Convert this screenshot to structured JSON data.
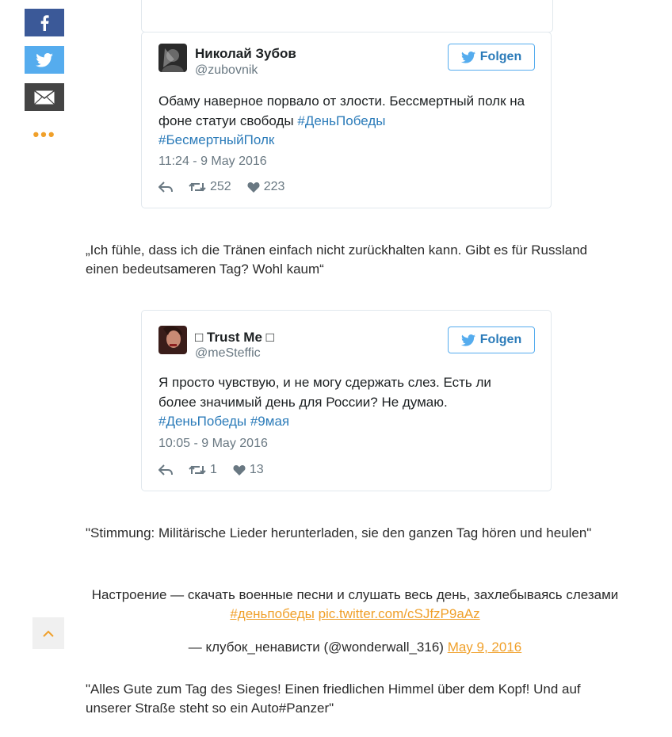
{
  "share": {
    "facebook_icon": "facebook-icon",
    "twitter_icon": "twitter-icon",
    "email_icon": "email-icon",
    "more_icon": "more-dots-icon"
  },
  "colors": {
    "facebook": "#3b5998",
    "twitter": "#55acee",
    "email": "#444444",
    "accent": "#f0a02a",
    "link_blue": "#2b7bb9"
  },
  "tweets": [
    {
      "name": "Николай Зубов",
      "handle": "@zubovnik",
      "follow_label": "Folgen",
      "text": "Обаму наверное порвало от злости. Бессмертный полк на фоне статуи свободы",
      "tags": [
        "#ДеньПобеды",
        "#БесмертныйПолк"
      ],
      "time": "11:24 - 9 May 2016",
      "retweets": "252",
      "likes": "223"
    },
    {
      "name": "□ Trust Me □",
      "handle": "@meSteffic",
      "follow_label": "Folgen",
      "text": "Я просто чувствую, и не могу сдержать слез. Есть ли более значимый день для России? Не думаю.",
      "tags": [
        "#ДеньПобеды",
        "#9мая"
      ],
      "time": "10:05 - 9 May 2016",
      "retweets": "1",
      "likes": "13"
    }
  ],
  "paragraphs": {
    "p1": " „Ich fühle, dass ich die Tränen einfach nicht zurückhalten kann. Gibt es für Russland einen bedeutsameren Tag? Wohl kaum“",
    "p2": "\"Stimmung: Militärische Lieder herunterladen, sie den ganzen Tag hören und heulen\"",
    "p3": "\"Alles Gute zum Tag des Sieges! Einen friedlichen Himmel über dem Kopf! Und auf unserer Straße steht so ein Auto#Panzer\""
  },
  "embed_quote": {
    "text": "Настроение — скачать военные песни и слушать весь день, захлебываясь слезами",
    "hashtag": "#деньпобеды",
    "pic_link": "pic.twitter.com/cSJfzP9aAz",
    "attribution": "— клубок_ненависти (@wonderwall_316)",
    "date_link": "May 9, 2016"
  },
  "scroll_top_icon": "chevron-up-icon"
}
